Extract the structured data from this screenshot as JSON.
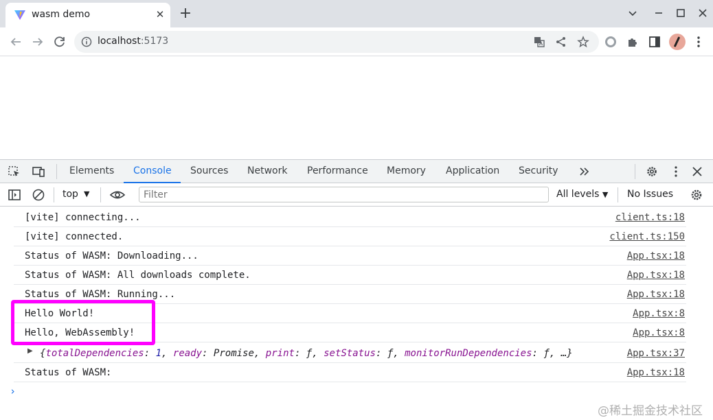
{
  "browser": {
    "tab_title": "wasm demo",
    "url_host": "localhost",
    "url_port": ":5173"
  },
  "devtools": {
    "tabs": [
      "Elements",
      "Console",
      "Sources",
      "Network",
      "Performance",
      "Memory",
      "Application",
      "Security"
    ],
    "active_tab": "Console",
    "context": "top",
    "filter_placeholder": "Filter",
    "levels": "All levels",
    "issues": "No Issues"
  },
  "console": {
    "messages": [
      {
        "text": "[vite] connecting...",
        "source": "client.ts:18"
      },
      {
        "text": "[vite] connected.",
        "source": "client.ts:150"
      },
      {
        "text": "Status of WASM: Downloading...",
        "source": "App.tsx:18"
      },
      {
        "text": "Status of WASM: All downloads complete.",
        "source": "App.tsx:18"
      },
      {
        "text": "Status of WASM: Running...",
        "source": "App.tsx:18"
      },
      {
        "text": "Hello World!",
        "source": "App.tsx:8"
      },
      {
        "text": "Hello, WebAssembly!",
        "source": "App.tsx:8"
      },
      {
        "text": "{totalDependencies: 1, ready: Promise, print: ƒ, setStatus: ƒ, monitorRunDependencies: ƒ, …}",
        "source": "App.tsx:37"
      },
      {
        "text": "Status of WASM:",
        "source": "App.tsx:18"
      }
    ],
    "object_parts": {
      "open": "{",
      "k1": "totalDependencies",
      "v1": "1",
      "k2": "ready",
      "v2": "Promise",
      "k3": "print",
      "v3": "ƒ",
      "k4": "setStatus",
      "v4": "ƒ",
      "k5": "monitorRunDependencies",
      "v5": "ƒ",
      "close": "…}"
    },
    "prompt": "›"
  },
  "watermark": "@稀土掘金技术社区",
  "colors": {
    "accent": "#1a73e8",
    "highlight": "#ff00ff"
  }
}
